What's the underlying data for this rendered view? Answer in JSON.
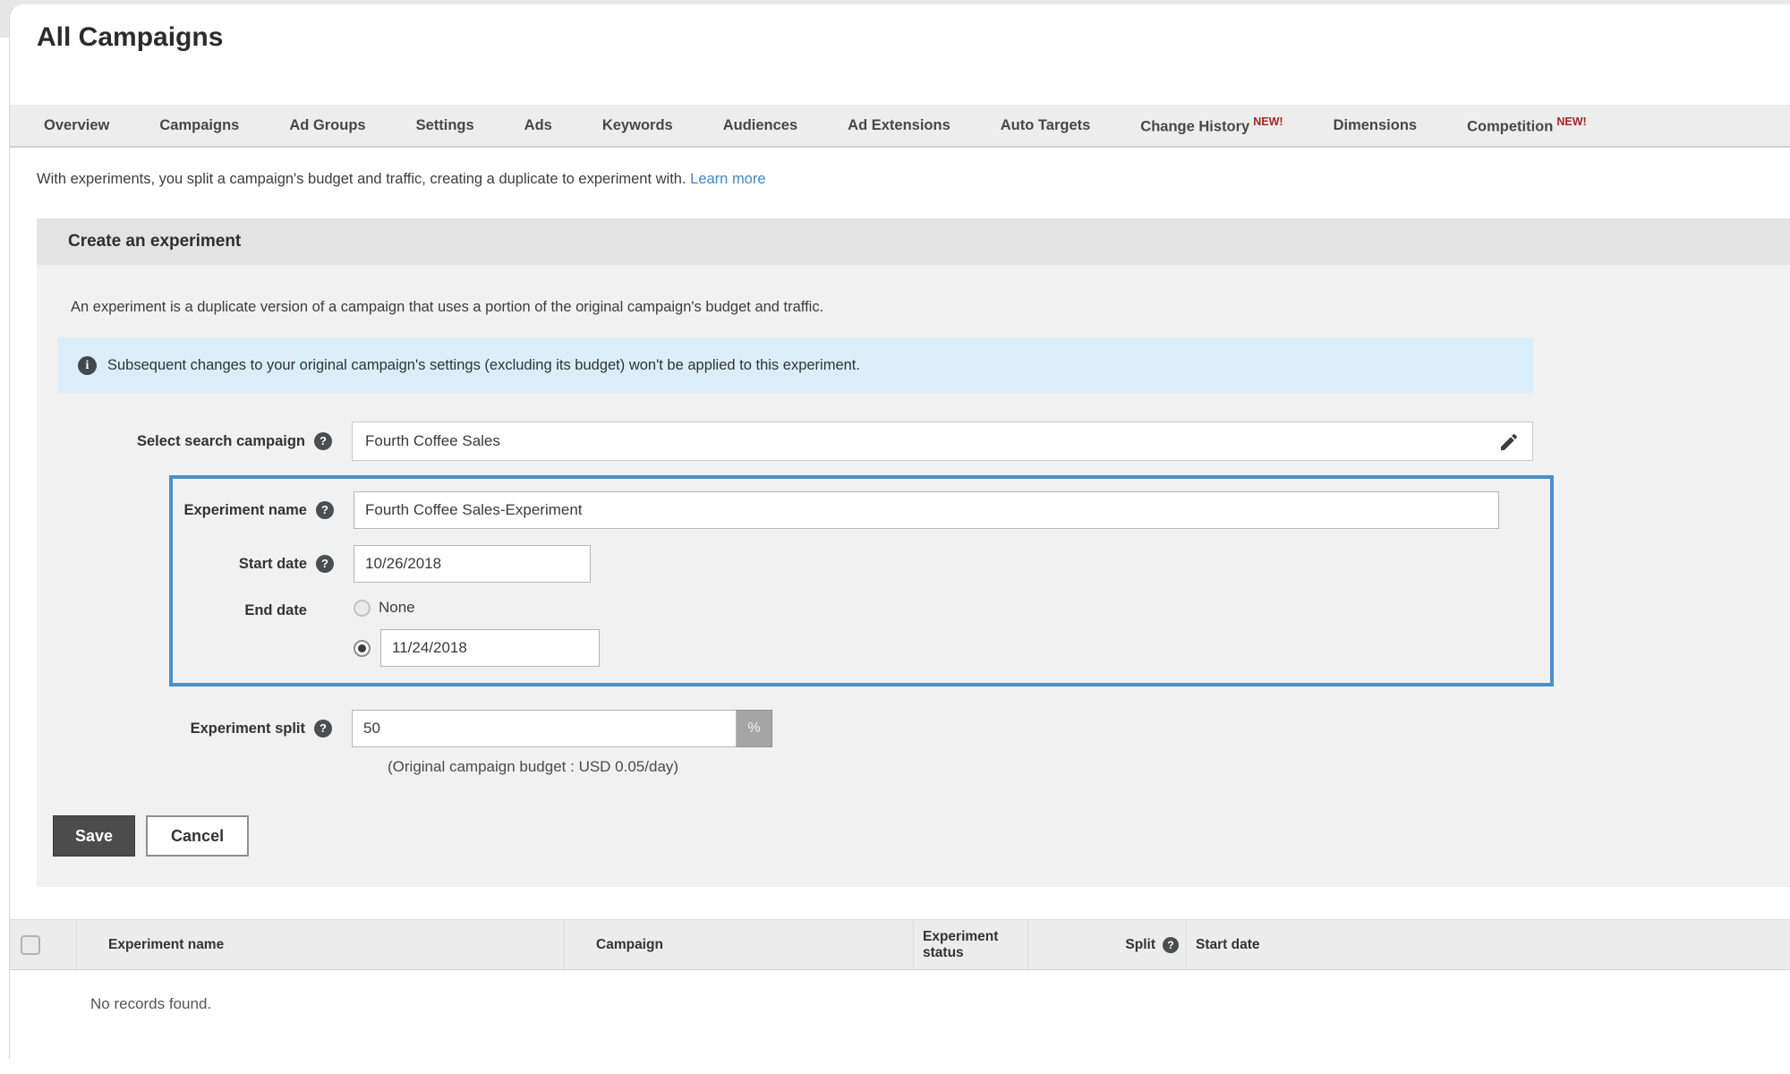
{
  "page": {
    "title": "All Campaigns"
  },
  "tabs": {
    "items": [
      {
        "label": "Overview",
        "badge": ""
      },
      {
        "label": "Campaigns",
        "badge": ""
      },
      {
        "label": "Ad Groups",
        "badge": ""
      },
      {
        "label": "Settings",
        "badge": ""
      },
      {
        "label": "Ads",
        "badge": ""
      },
      {
        "label": "Keywords",
        "badge": ""
      },
      {
        "label": "Audiences",
        "badge": ""
      },
      {
        "label": "Ad Extensions",
        "badge": ""
      },
      {
        "label": "Auto Targets",
        "badge": ""
      },
      {
        "label": "Change History",
        "badge": "NEW!"
      },
      {
        "label": "Dimensions",
        "badge": ""
      },
      {
        "label": "Competition",
        "badge": "NEW!"
      }
    ]
  },
  "intro": {
    "text": "With experiments, you split a campaign's budget and traffic, creating a duplicate to experiment with.",
    "link": "Learn more"
  },
  "panel": {
    "title": "Create an experiment",
    "description": "An experiment is a duplicate version of a campaign that uses a portion of the original campaign's budget and traffic.",
    "notice": "Subsequent changes to your original campaign's settings (excluding its budget) won't be applied to this experiment.",
    "form": {
      "select_campaign": {
        "label": "Select search campaign",
        "value": "Fourth Coffee Sales"
      },
      "experiment_name": {
        "label": "Experiment name",
        "value": "Fourth Coffee Sales-Experiment"
      },
      "start_date": {
        "label": "Start date",
        "value": "10/26/2018"
      },
      "end_date": {
        "label": "End date",
        "none_label": "None",
        "value": "11/24/2018"
      },
      "experiment_split": {
        "label": "Experiment split",
        "value": "50",
        "unit": "%",
        "budget_note": "(Original campaign budget : USD 0.05/day)"
      }
    },
    "buttons": {
      "save": "Save",
      "cancel": "Cancel"
    }
  },
  "table": {
    "columns": [
      "Experiment name",
      "Campaign",
      "Experiment status",
      "Split",
      "Start date"
    ],
    "empty_message": "No records found."
  },
  "icons": {
    "help": "?",
    "info": "i"
  },
  "colors": {
    "highlight_border": "#4a90c9",
    "notice_background": "#d9eef8",
    "link_blue": "#3f87c6",
    "badge_red": "#a32626",
    "save_button": "#4c4c4c"
  }
}
